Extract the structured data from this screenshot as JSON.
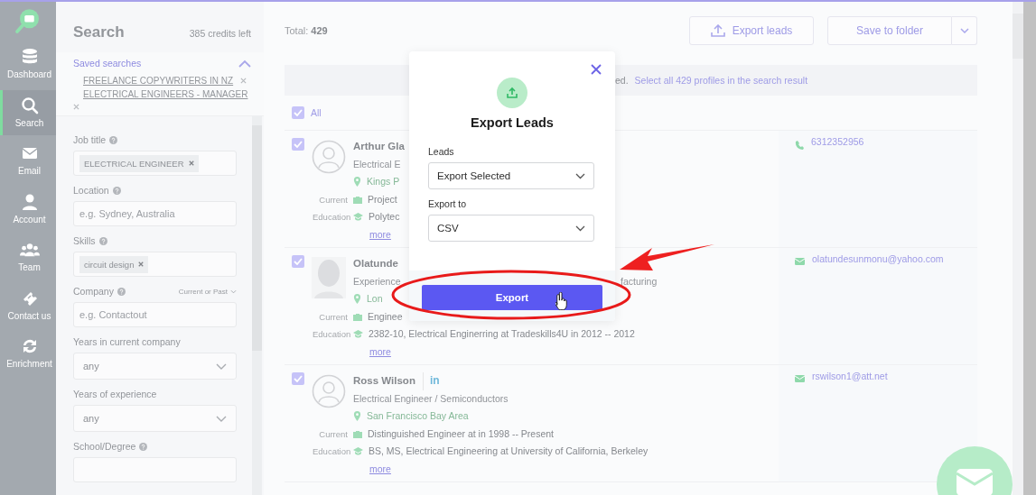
{
  "sidebar": {
    "items": [
      {
        "label": "Dashboard",
        "selected": false
      },
      {
        "label": "Search",
        "selected": true
      },
      {
        "label": "Email",
        "selected": false
      },
      {
        "label": "Account",
        "selected": false
      },
      {
        "label": "Team",
        "selected": false
      },
      {
        "label": "Contact us",
        "selected": false
      },
      {
        "label": "Enrichment",
        "selected": false
      }
    ]
  },
  "filters": {
    "title": "Search",
    "credits": "385 credits left",
    "saved_searches": {
      "label": "Saved searches",
      "expanded": true,
      "items": [
        "FREELANCE COPYWRITERS IN NZ",
        "ELECTRICAL ENGINEERS - MANAGER"
      ]
    },
    "fields": [
      {
        "kind": "chips",
        "label": "Job title",
        "help": true,
        "chips": [
          "ELECTRICAL ENGINEER"
        ]
      },
      {
        "kind": "text",
        "label": "Location",
        "help": true,
        "placeholder": "e.g. Sydney, Australia"
      },
      {
        "kind": "chips",
        "label": "Skills",
        "help": true,
        "chips": [
          "circuit design"
        ]
      },
      {
        "kind": "text",
        "label": "Company",
        "help": true,
        "option": "Current or Past",
        "placeholder": "e.g. Contactout"
      },
      {
        "kind": "select",
        "label": "Years in current company",
        "help": false,
        "value": "any"
      },
      {
        "kind": "select",
        "label": "Years of experience",
        "help": false,
        "value": "any"
      },
      {
        "kind": "text",
        "label": "School/Degree",
        "help": true
      }
    ]
  },
  "main": {
    "total": "Total: **429**",
    "export_button": "Export leads",
    "save_button": "Save to folder",
    "banner": {
      "text": "ed.",
      "link": "Select all 429 profiles in the search result"
    },
    "select_all": {
      "label": "All",
      "checked": true
    },
    "rows": [
      {
        "checked": true,
        "avatar": {
          "kind": "placeholder"
        },
        "name": "Arthur Gla",
        "headline": "Electrical E",
        "location": "Kings P",
        "current_label": "Current",
        "current": "Project",
        "education_label": "Education",
        "education": "Polytec",
        "more": "more",
        "contact": {
          "kind": "phone",
          "text": "6312352956"
        }
      },
      {
        "checked": true,
        "name": "Olatunde",
        "headline": "Experience",
        "headline_tail": "facturing",
        "location": "Lon",
        "current_label": "Current",
        "current": "Enginee",
        "education_label": "Education",
        "education": "2382-10, Electrical Enginerring at Tradeskills4U in 2012 -- 2012",
        "more": "more",
        "contact": {
          "kind": "email",
          "text": "olatundesunmonu@yahoo.com"
        }
      },
      {
        "checked": true,
        "avatar": {
          "kind": "placeholder"
        },
        "name": "Ross Wilson",
        "linkedin": "in",
        "headline": "Electrical Engineer / Semiconductors",
        "location": "San Francisco Bay Area",
        "current_label": "Current",
        "current": "Distinguished Engineer at in 1998 -- Present",
        "education_label": "Education",
        "education": "BS, MS, Electrical Engineering at University of California, Berkeley",
        "more": "more",
        "contact": {
          "kind": "email",
          "text": "rswilson1@att.net"
        }
      }
    ]
  },
  "modal": {
    "title": "Export Leads",
    "fields": [
      {
        "label": "Leads",
        "value": "Export Selected"
      },
      {
        "label": "Export to",
        "value": "CSV"
      }
    ],
    "button": "Export"
  }
}
